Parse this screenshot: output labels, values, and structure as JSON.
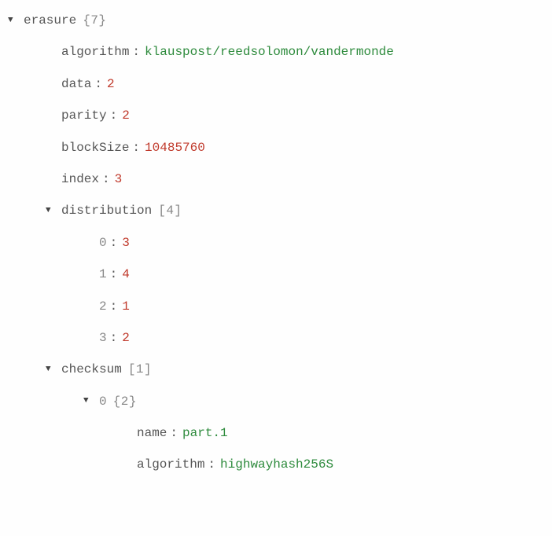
{
  "tree": {
    "erasure": {
      "label": "erasure",
      "meta": "{7}",
      "fields": {
        "algorithm": {
          "key": "algorithm",
          "value": "klauspost/reedsolomon/vandermonde"
        },
        "data": {
          "key": "data",
          "value": "2"
        },
        "parity": {
          "key": "parity",
          "value": "2"
        },
        "blockSize": {
          "key": "blockSize",
          "value": "10485760"
        },
        "index": {
          "key": "index",
          "value": "3"
        }
      },
      "distribution": {
        "label": "distribution",
        "meta": "[4]",
        "items": [
          {
            "key": "0",
            "value": "3"
          },
          {
            "key": "1",
            "value": "4"
          },
          {
            "key": "2",
            "value": "1"
          },
          {
            "key": "3",
            "value": "2"
          }
        ]
      },
      "checksum": {
        "label": "checksum",
        "meta": "[1]",
        "items": [
          {
            "key": "0",
            "meta": "{2}",
            "fields": {
              "name": {
                "key": "name",
                "value": "part.1"
              },
              "algorithm": {
                "key": "algorithm",
                "value": "highwayhash256S"
              }
            }
          }
        ]
      }
    }
  }
}
